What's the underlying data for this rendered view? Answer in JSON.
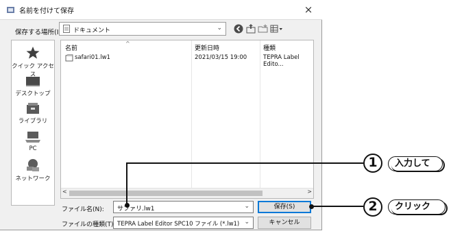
{
  "window": {
    "title": "名前を付けて保存",
    "close_glyph": "×"
  },
  "location": {
    "label": "保存する場所(I):",
    "value": "ドキュメント"
  },
  "places": [
    {
      "id": "quick-access",
      "label": "クイック アクセス",
      "icon": "star-icon"
    },
    {
      "id": "desktop",
      "label": "デスクトップ",
      "icon": "desktop-icon"
    },
    {
      "id": "libraries",
      "label": "ライブラリ",
      "icon": "library-icon"
    },
    {
      "id": "pc",
      "label": "PC",
      "icon": "computer-icon"
    },
    {
      "id": "network",
      "label": "ネットワーク",
      "icon": "network-icon"
    }
  ],
  "file_list": {
    "columns": [
      "名前",
      "更新日時",
      "種類"
    ],
    "sort_indicator": "^",
    "rows": [
      {
        "name": "safari01.lw1",
        "modified": "2021/03/15 19:00",
        "type": "TEPRA Label Edito..."
      }
    ]
  },
  "filename": {
    "label": "ファイル名(N):",
    "value": "サファリ.lw1"
  },
  "filetype": {
    "label": "ファイルの種類(T):",
    "value": "TEPRA Label Editor SPC10 ファイル (*.lw1)"
  },
  "buttons": {
    "save": "保存(S)",
    "cancel": "キャンセル"
  },
  "annotations": [
    {
      "number": "1",
      "text": "入力して"
    },
    {
      "number": "2",
      "text": "クリック"
    }
  ],
  "colors": {
    "accent": "#0078d7",
    "dialog_bg": "#f0f0f0"
  }
}
